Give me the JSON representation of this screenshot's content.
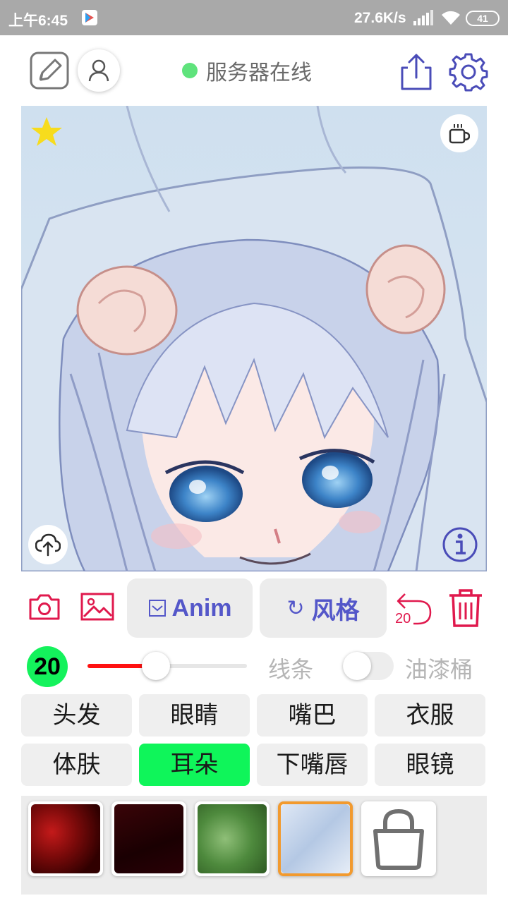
{
  "status_bar": {
    "time": "上午6:45",
    "network_speed": "27.6K/s",
    "battery": "41"
  },
  "toolbar": {
    "server_status": "服务器在线",
    "server_status_color": "#5fe37c",
    "icons": [
      "sketch-icon",
      "user-icon",
      "share-icon",
      "settings-icon"
    ]
  },
  "canvas": {
    "icons": [
      "star-icon",
      "coffee-icon",
      "cloud-upload-icon",
      "info-icon"
    ]
  },
  "actions": {
    "anim_label": "Anim",
    "style_label": "风格",
    "style_icon": "↻",
    "undo_count": "20",
    "accent": "#5457c9",
    "danger": "#e0194d"
  },
  "controls": {
    "brush_size": "20",
    "slider_fraction": 0.43,
    "lines_label": "线条",
    "bucket_label": "油漆桶",
    "bucket_toggle_on": false
  },
  "parts": [
    {
      "label": "头发",
      "active": false
    },
    {
      "label": "眼睛",
      "active": false
    },
    {
      "label": "嘴巴",
      "active": false
    },
    {
      "label": "衣服",
      "active": false
    },
    {
      "label": "体肤",
      "active": false
    },
    {
      "label": "耳朵",
      "active": true
    },
    {
      "label": "下嘴唇",
      "active": false
    },
    {
      "label": "眼镜",
      "active": false
    }
  ],
  "textures": [
    {
      "name": "red-scale-texture",
      "selected": false
    },
    {
      "name": "dark-red-texture",
      "selected": false
    },
    {
      "name": "green-vine-texture",
      "selected": false
    },
    {
      "name": "ice-blue-texture",
      "selected": true
    },
    {
      "name": "locked-texture",
      "selected": false
    }
  ]
}
